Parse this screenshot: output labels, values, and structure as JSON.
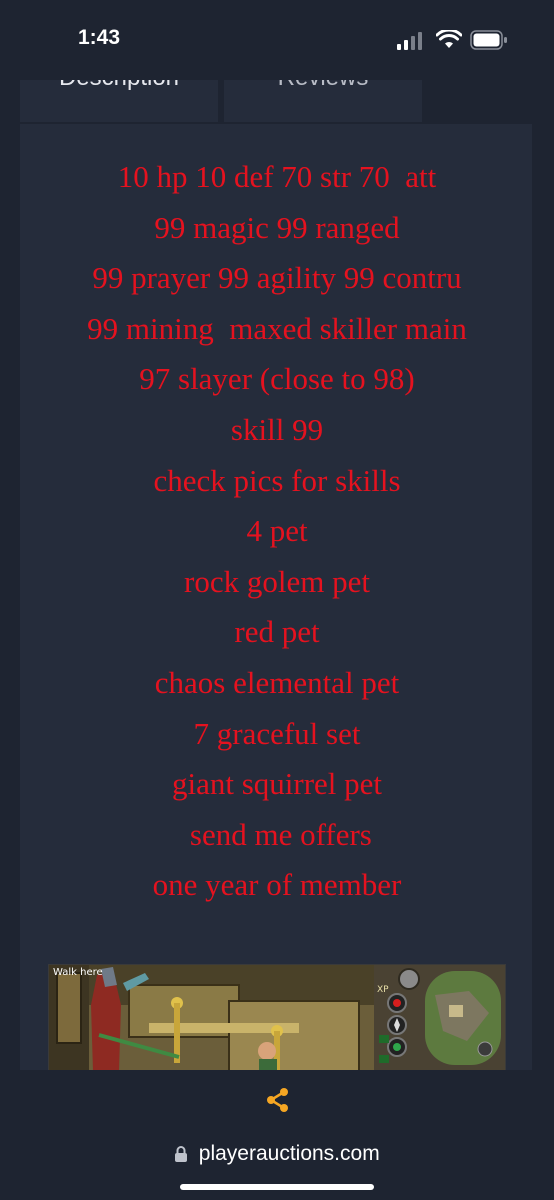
{
  "status_bar": {
    "time": "1:43",
    "icons": [
      "cellular-signal-icon",
      "wifi-icon",
      "battery-icon"
    ]
  },
  "tabs": [
    {
      "label": "Description",
      "active": true
    },
    {
      "label": "Reviews",
      "active": false
    }
  ],
  "description": {
    "text_color": "#e5121f",
    "lines": [
      "10 hp 10 def 70 str 70  att",
      "99 magic 99 ranged",
      "99 prayer 99 agility 99 contru",
      "99 mining  maxed skiller main",
      "97 slayer (close to 98)",
      "skill 99",
      "check pics for skills",
      "4 pet",
      "rock golem pet",
      "red pet",
      "chaos elemental pet",
      "7 graceful set",
      "giant squirrel pet",
      " send me offers",
      "one year of member"
    ]
  },
  "screenshot": {
    "label": "Walk here",
    "hud_label": "XP"
  },
  "toolbar": {
    "share_icon": "share-icon",
    "share_color": "#f5a623"
  },
  "address_bar": {
    "url": "playerauctions.com",
    "icon": "lock-icon"
  },
  "colors": {
    "background": "#1e2431",
    "panel": "#252c3b",
    "accent": "#f5a623"
  }
}
